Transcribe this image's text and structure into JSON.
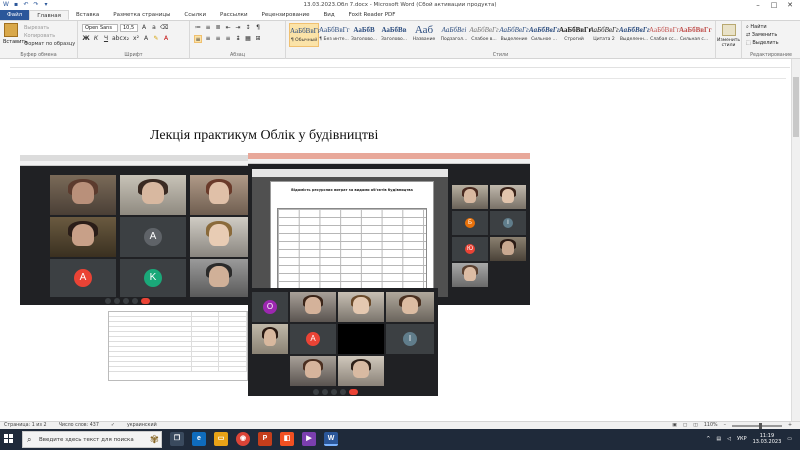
{
  "window": {
    "title": "13.03.2023.Обл 7.docx - Microsoft Word (Сбой активации продукта)"
  },
  "ribbon_tabs": [
    "Файл",
    "Главная",
    "Вставка",
    "Разметка страницы",
    "Ссылки",
    "Рассылки",
    "Рецензирование",
    "Вид",
    "Foxit Reader PDF"
  ],
  "clipboard": {
    "paste": "Вставить",
    "cut": "Вырезать",
    "copy": "Копировать",
    "format_painter": "Формат по образцу",
    "label": "Буфер обмена"
  },
  "font": {
    "family": "Open Sans",
    "size": "10,5",
    "label": "Шрифт"
  },
  "paragraph": {
    "label": "Абзац"
  },
  "styles": {
    "items": [
      {
        "sample": "АаБбВвГг",
        "name": "¶ Обычный"
      },
      {
        "sample": "АаБбВвГг",
        "name": "¶ Без инте..."
      },
      {
        "sample": "АаБбВ",
        "name": "Заголово..."
      },
      {
        "sample": "АаБбВв",
        "name": "Заголово..."
      },
      {
        "sample": "Ааб",
        "name": "Название"
      },
      {
        "sample": "АаБбВеі",
        "name": "Подзагол..."
      },
      {
        "sample": "АаБбВвГг",
        "name": "Слабое в..."
      },
      {
        "sample": "АаБбВвГг",
        "name": "Выделение"
      },
      {
        "sample": "АаБбВвГг",
        "name": "Сильное ..."
      },
      {
        "sample": "АаБбВвГг",
        "name": "Строгий"
      },
      {
        "sample": "АаБбВвГг",
        "name": "Цитата 2"
      },
      {
        "sample": "АаБбВвГг",
        "name": "Выделенн..."
      },
      {
        "sample": "АаБбВвГг",
        "name": "Слабая сс..."
      },
      {
        "sample": "АаБбВвГг",
        "name": "Сильная с..."
      }
    ],
    "change_styles": "Изменить стили",
    "label": "Стили"
  },
  "editing": {
    "find": "Найти",
    "replace": "Заменить",
    "select": "Выделить",
    "label": "Редактирование"
  },
  "document": {
    "heading": "Лекція практикум Облік у будівництві"
  },
  "meet": {
    "avatars": [
      "A",
      "K",
      "A",
      "O",
      "A",
      "I",
      "Б",
      "Ю",
      "I"
    ],
    "sheet_title": "Відомість ресурсних витрат за видами об'єктів будівництва"
  },
  "status": {
    "page": "Страница: 1 из 2",
    "words": "Число слов: 437",
    "lang": "украинский",
    "zoom": "110%"
  },
  "taskbar": {
    "search_placeholder": "Введите здесь текст для поиска",
    "lang": "УКР",
    "time": "11:19",
    "date": "13.03.2023"
  }
}
